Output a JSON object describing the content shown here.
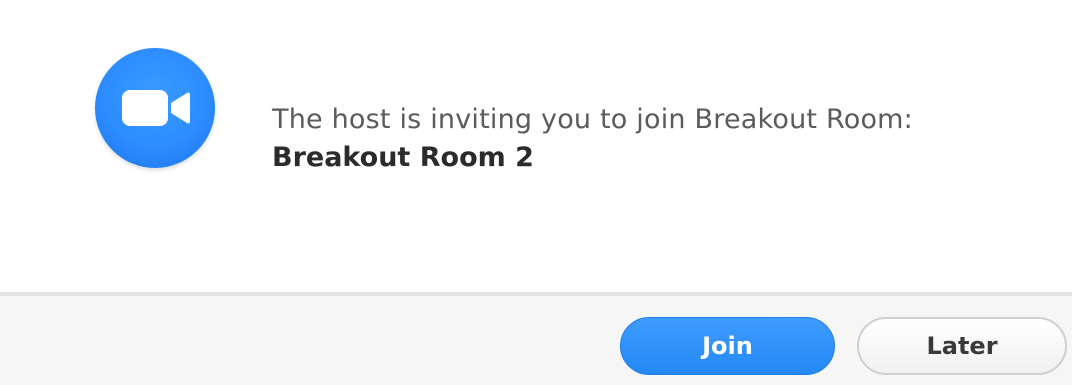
{
  "dialog": {
    "icon": "zoom-video-camera-icon",
    "message": "The host is inviting you to join Breakout Room:",
    "room_name": "Breakout Room 2"
  },
  "buttons": {
    "join_label": "Join",
    "later_label": "Later"
  },
  "colors": {
    "accent": "#2d8cff",
    "footer_bg": "#f6f6f6"
  }
}
